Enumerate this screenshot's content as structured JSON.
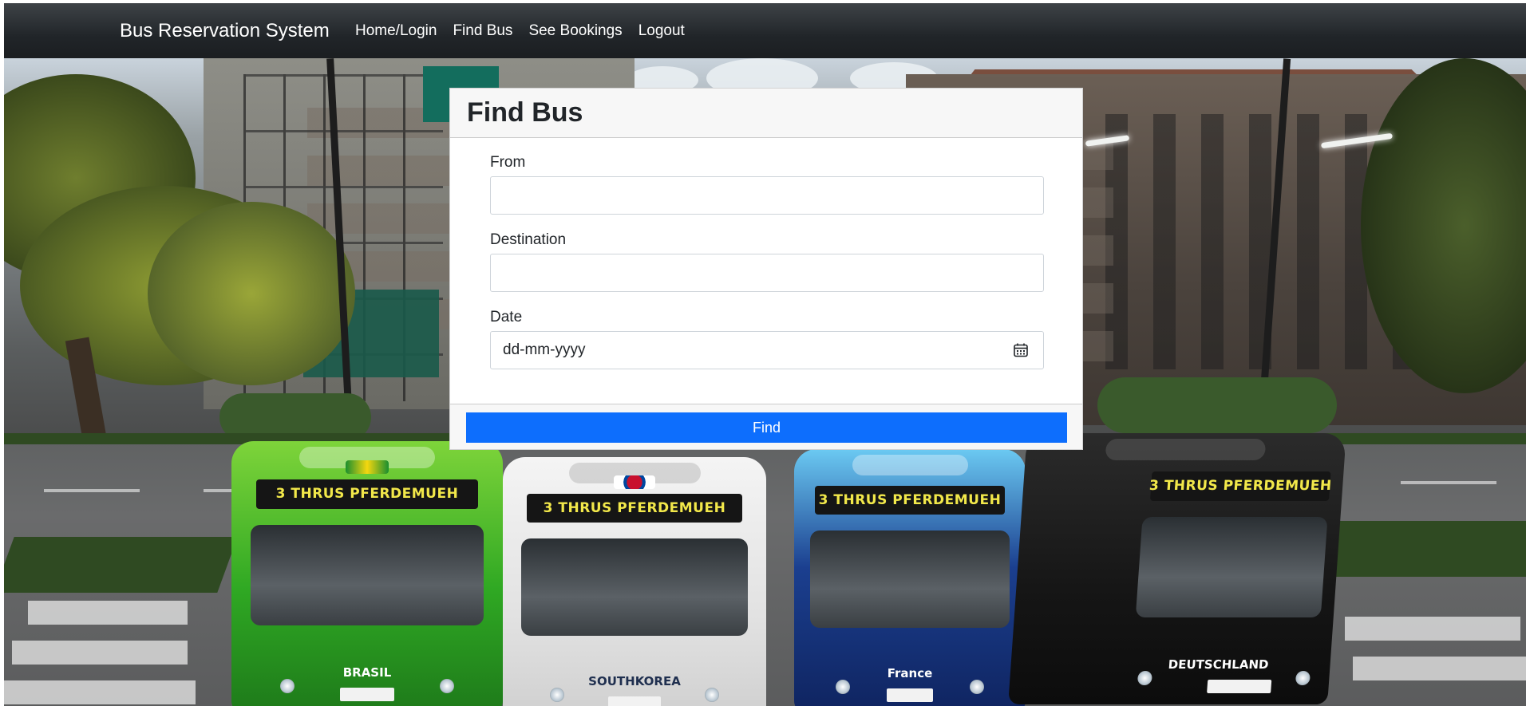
{
  "navbar": {
    "brand": "Bus Reservation System",
    "links": [
      {
        "label": "Home/Login"
      },
      {
        "label": "Find Bus"
      },
      {
        "label": "See Bookings"
      },
      {
        "label": "Logout"
      }
    ]
  },
  "background": {
    "description_icon": "bus-photo-background",
    "bus_signs": [
      "3 THRUS PFERDEMUEH",
      "3 THRUS PFERDEMUEH",
      "3 THRUS PFERDEMUEH",
      "3 THRUS PFERDEMUEH"
    ],
    "bus_names": [
      "BRASIL",
      "SOUTHKOREA",
      "France",
      "DEUTSCHLAND"
    ]
  },
  "form": {
    "title": "Find Bus",
    "from_label": "From",
    "from_value": "",
    "destination_label": "Destination",
    "destination_value": "",
    "date_label": "Date",
    "date_placeholder": "dd-mm-yyyy",
    "calendar_icon": "calendar-icon",
    "submit_label": "Find"
  },
  "colors": {
    "navbar": "#212529",
    "primary_button": "#0d6efd",
    "card_header": "#f7f7f7"
  }
}
